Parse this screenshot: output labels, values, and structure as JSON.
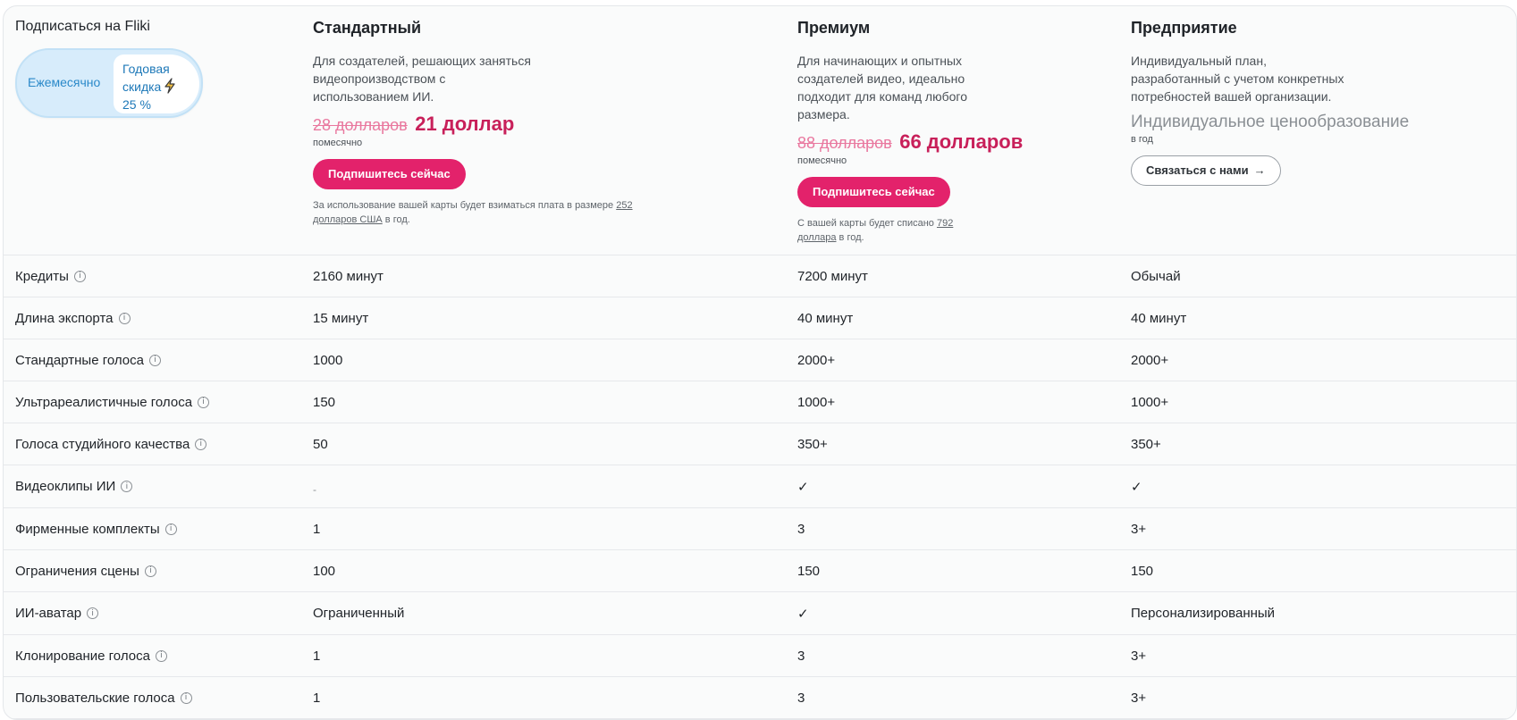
{
  "subscribe_title": "Подписаться на Fliki",
  "billing_toggle": {
    "monthly_label": "Ежемесячно",
    "yearly_line1": "Годовая",
    "yearly_line2": "скидка",
    "yearly_line3": "25 %",
    "bolt_icon": "lightning-bolt-icon"
  },
  "plans": [
    {
      "name": "Стандартный",
      "description": [
        "Для создателей, решающих заняться",
        "видеопроизводством с",
        "использованием ИИ."
      ],
      "old_price": "28 долларов",
      "new_price": "21 доллар",
      "period": "помесячно",
      "button_label": "Подпишитесь сейчас",
      "note_before": "За использование вашей карты будет взиматься плата в размере ",
      "note_link1": "252",
      "note_link2": "долларов США",
      "note_after": " в год."
    },
    {
      "name": "Премиум",
      "description": [
        "Для начинающих и опытных",
        "создателей видео, идеально",
        "подходит для команд любого",
        "размера."
      ],
      "old_price": "88 долларов",
      "new_price": "66 долларов",
      "period": "помесячно",
      "button_label": "Подпишитесь сейчас",
      "note_before": "С вашей карты будет списано ",
      "note_link1": "792",
      "note_link2": "доллара",
      "note_after": " в год."
    },
    {
      "name": "Предприятие",
      "description": [
        "Индивидуальный план,",
        "разработанный с учетом конкретных",
        "потребностей вашей организации."
      ],
      "price": "Индивидуальное ценообразование",
      "period": "в год",
      "button_label": "Связаться с нами",
      "button_icon": "arrow-right-icon"
    }
  ],
  "features": [
    {
      "label": "Кредиты",
      "standard": "2160 минут",
      "premium": "7200 минут",
      "enterprise": "Обычай"
    },
    {
      "label": "Длина экспорта",
      "standard": "15 минут",
      "premium": "40 минут",
      "enterprise": "40 минут"
    },
    {
      "label": "Стандартные голоса",
      "standard": "1000",
      "premium": "2000+",
      "enterprise": "2000+"
    },
    {
      "label": "Ультрареалистичные голоса",
      "standard": "150",
      "premium": "1000+",
      "enterprise": "1000+"
    },
    {
      "label": "Голоса студийного качества",
      "standard": "50",
      "premium": "350+",
      "enterprise": "350+"
    },
    {
      "label": "Видеоклипы ИИ",
      "standard": "-",
      "premium": "✓",
      "enterprise": "✓"
    },
    {
      "label": "Фирменные комплекты",
      "standard": "1",
      "premium": "3",
      "enterprise": "3+"
    },
    {
      "label": "Ограничения сцены",
      "standard": "100",
      "premium": "150",
      "enterprise": "150"
    },
    {
      "label": "ИИ-аватар",
      "standard": "Ограниченный",
      "premium": "✓",
      "enterprise": "Персонализированный"
    },
    {
      "label": "Клонирование голоса",
      "standard": "1",
      "premium": "3",
      "enterprise": "3+"
    },
    {
      "label": "Пользовательские голоса",
      "standard": "1",
      "premium": "3",
      "enterprise": "3+"
    }
  ],
  "info_icon": "info-circle-icon",
  "check_icon": "checkmark-icon",
  "colors": {
    "accent": "#e3226b",
    "price": "#c8205a",
    "old_price": "#e9789f",
    "toggle_bg": "#d7ecfb",
    "toggle_text": "#2a89c9"
  }
}
